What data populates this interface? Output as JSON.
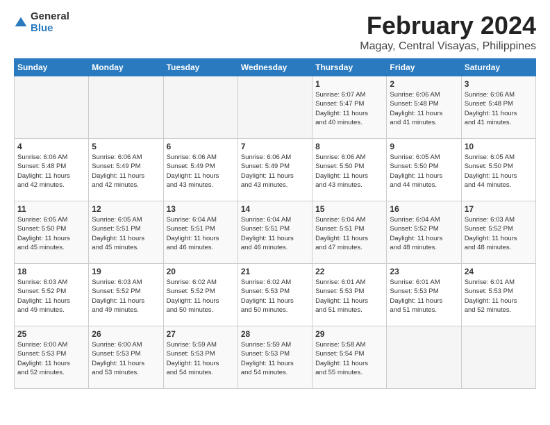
{
  "logo": {
    "general": "General",
    "blue": "Blue"
  },
  "title": "February 2024",
  "subtitle": "Magay, Central Visayas, Philippines",
  "days_of_week": [
    "Sunday",
    "Monday",
    "Tuesday",
    "Wednesday",
    "Thursday",
    "Friday",
    "Saturday"
  ],
  "weeks": [
    [
      {
        "day": "",
        "info": ""
      },
      {
        "day": "",
        "info": ""
      },
      {
        "day": "",
        "info": ""
      },
      {
        "day": "",
        "info": ""
      },
      {
        "day": "1",
        "info": "Sunrise: 6:07 AM\nSunset: 5:47 PM\nDaylight: 11 hours\nand 40 minutes."
      },
      {
        "day": "2",
        "info": "Sunrise: 6:06 AM\nSunset: 5:48 PM\nDaylight: 11 hours\nand 41 minutes."
      },
      {
        "day": "3",
        "info": "Sunrise: 6:06 AM\nSunset: 5:48 PM\nDaylight: 11 hours\nand 41 minutes."
      }
    ],
    [
      {
        "day": "4",
        "info": "Sunrise: 6:06 AM\nSunset: 5:48 PM\nDaylight: 11 hours\nand 42 minutes."
      },
      {
        "day": "5",
        "info": "Sunrise: 6:06 AM\nSunset: 5:49 PM\nDaylight: 11 hours\nand 42 minutes."
      },
      {
        "day": "6",
        "info": "Sunrise: 6:06 AM\nSunset: 5:49 PM\nDaylight: 11 hours\nand 43 minutes."
      },
      {
        "day": "7",
        "info": "Sunrise: 6:06 AM\nSunset: 5:49 PM\nDaylight: 11 hours\nand 43 minutes."
      },
      {
        "day": "8",
        "info": "Sunrise: 6:06 AM\nSunset: 5:50 PM\nDaylight: 11 hours\nand 43 minutes."
      },
      {
        "day": "9",
        "info": "Sunrise: 6:05 AM\nSunset: 5:50 PM\nDaylight: 11 hours\nand 44 minutes."
      },
      {
        "day": "10",
        "info": "Sunrise: 6:05 AM\nSunset: 5:50 PM\nDaylight: 11 hours\nand 44 minutes."
      }
    ],
    [
      {
        "day": "11",
        "info": "Sunrise: 6:05 AM\nSunset: 5:50 PM\nDaylight: 11 hours\nand 45 minutes."
      },
      {
        "day": "12",
        "info": "Sunrise: 6:05 AM\nSunset: 5:51 PM\nDaylight: 11 hours\nand 45 minutes."
      },
      {
        "day": "13",
        "info": "Sunrise: 6:04 AM\nSunset: 5:51 PM\nDaylight: 11 hours\nand 46 minutes."
      },
      {
        "day": "14",
        "info": "Sunrise: 6:04 AM\nSunset: 5:51 PM\nDaylight: 11 hours\nand 46 minutes."
      },
      {
        "day": "15",
        "info": "Sunrise: 6:04 AM\nSunset: 5:51 PM\nDaylight: 11 hours\nand 47 minutes."
      },
      {
        "day": "16",
        "info": "Sunrise: 6:04 AM\nSunset: 5:52 PM\nDaylight: 11 hours\nand 48 minutes."
      },
      {
        "day": "17",
        "info": "Sunrise: 6:03 AM\nSunset: 5:52 PM\nDaylight: 11 hours\nand 48 minutes."
      }
    ],
    [
      {
        "day": "18",
        "info": "Sunrise: 6:03 AM\nSunset: 5:52 PM\nDaylight: 11 hours\nand 49 minutes."
      },
      {
        "day": "19",
        "info": "Sunrise: 6:03 AM\nSunset: 5:52 PM\nDaylight: 11 hours\nand 49 minutes."
      },
      {
        "day": "20",
        "info": "Sunrise: 6:02 AM\nSunset: 5:52 PM\nDaylight: 11 hours\nand 50 minutes."
      },
      {
        "day": "21",
        "info": "Sunrise: 6:02 AM\nSunset: 5:53 PM\nDaylight: 11 hours\nand 50 minutes."
      },
      {
        "day": "22",
        "info": "Sunrise: 6:01 AM\nSunset: 5:53 PM\nDaylight: 11 hours\nand 51 minutes."
      },
      {
        "day": "23",
        "info": "Sunrise: 6:01 AM\nSunset: 5:53 PM\nDaylight: 11 hours\nand 51 minutes."
      },
      {
        "day": "24",
        "info": "Sunrise: 6:01 AM\nSunset: 5:53 PM\nDaylight: 11 hours\nand 52 minutes."
      }
    ],
    [
      {
        "day": "25",
        "info": "Sunrise: 6:00 AM\nSunset: 5:53 PM\nDaylight: 11 hours\nand 52 minutes."
      },
      {
        "day": "26",
        "info": "Sunrise: 6:00 AM\nSunset: 5:53 PM\nDaylight: 11 hours\nand 53 minutes."
      },
      {
        "day": "27",
        "info": "Sunrise: 5:59 AM\nSunset: 5:53 PM\nDaylight: 11 hours\nand 54 minutes."
      },
      {
        "day": "28",
        "info": "Sunrise: 5:59 AM\nSunset: 5:53 PM\nDaylight: 11 hours\nand 54 minutes."
      },
      {
        "day": "29",
        "info": "Sunrise: 5:58 AM\nSunset: 5:54 PM\nDaylight: 11 hours\nand 55 minutes."
      },
      {
        "day": "",
        "info": ""
      },
      {
        "day": "",
        "info": ""
      }
    ]
  ]
}
